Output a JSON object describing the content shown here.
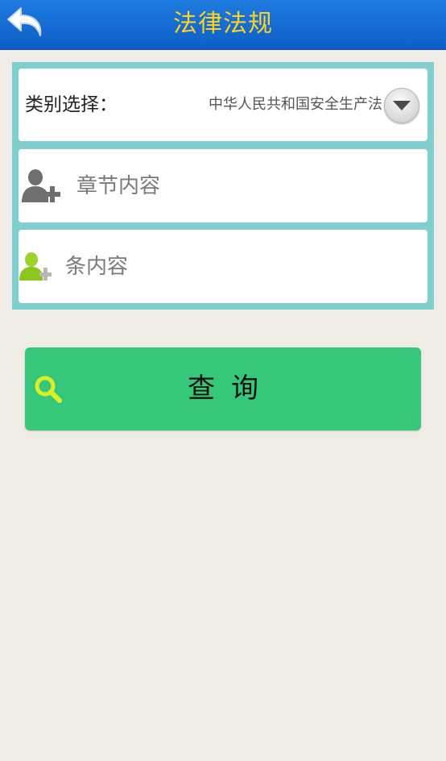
{
  "header": {
    "title": "法律法规",
    "back_icon": "back-arrow-icon"
  },
  "form": {
    "category_label": "类别选择：",
    "category_value": "中华人民共和国安全生产法",
    "dropdown_icon": "dropdown-arrow-icon",
    "chapter_placeholder": "章节内容",
    "chapter_icon": "add-user-icon",
    "article_placeholder": "条内容",
    "article_icon": "add-user-green-icon"
  },
  "actions": {
    "query_label": "查询",
    "query_icon": "search-icon"
  },
  "colors": {
    "header_blue": "#1f7ae0",
    "title_yellow": "#ffd21f",
    "panel_teal": "#7fcfcf",
    "button_green": "#37c77a",
    "background": "#efebe6"
  }
}
